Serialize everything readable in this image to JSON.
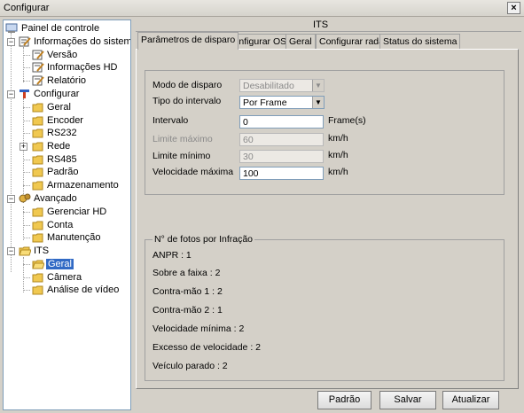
{
  "window": {
    "title": "Configurar",
    "close_label": "×"
  },
  "tree": {
    "root": "Painel de controle",
    "info_system": "Informações do sistema",
    "version": "Versão",
    "hd_info": "Informações HD",
    "report": "Relatório",
    "configure": "Configurar",
    "general": "Geral",
    "encoder": "Encoder",
    "rs232": "RS232",
    "network": "Rede",
    "rs485": "RS485",
    "default": "Padrão",
    "storage": "Armazenamento",
    "advanced": "Avançado",
    "manage_hd": "Gerenciar HD",
    "account": "Conta",
    "maintenance": "Manutenção",
    "its": "ITS",
    "its_general": "Geral",
    "camera": "Câmera",
    "video_analysis": "Análise de vídeo"
  },
  "panel": {
    "title": "ITS",
    "tabs": [
      "Parâmetros de disparo",
      "Configurar OSD",
      "Geral",
      "Configurar radar",
      "Status do sistema"
    ]
  },
  "form": {
    "trigger_mode_label": "Modo de disparo",
    "trigger_mode_value": "Desabilitado",
    "interval_type_label": "Tipo do intervalo",
    "interval_type_value": "Por Frame",
    "interval_label": "Intervalo",
    "interval_value": "0",
    "interval_unit": "Frame(s)",
    "max_limit_label": "Limite máximo",
    "max_limit_value": "60",
    "max_limit_unit": "km/h",
    "min_limit_label": "Limite mínimo",
    "min_limit_value": "30",
    "min_limit_unit": "km/h",
    "max_speed_label": "Velocidade máxima",
    "max_speed_value": "100",
    "max_speed_unit": "km/h"
  },
  "photos": {
    "title": "N° de fotos por Infração",
    "anpr": "ANPR : 1",
    "lane": "Sobre a faixa : 2",
    "contra1": "Contra-mão 1 : 2",
    "contra2": "Contra-mão 2 : 1",
    "min_speed": "Velocidade mínima : 2",
    "overspeed": "Excesso de velocidade : 2",
    "stopped": "Veículo parado : 2"
  },
  "buttons": {
    "default": "Padrão",
    "save": "Salvar",
    "refresh": "Atualizar"
  }
}
